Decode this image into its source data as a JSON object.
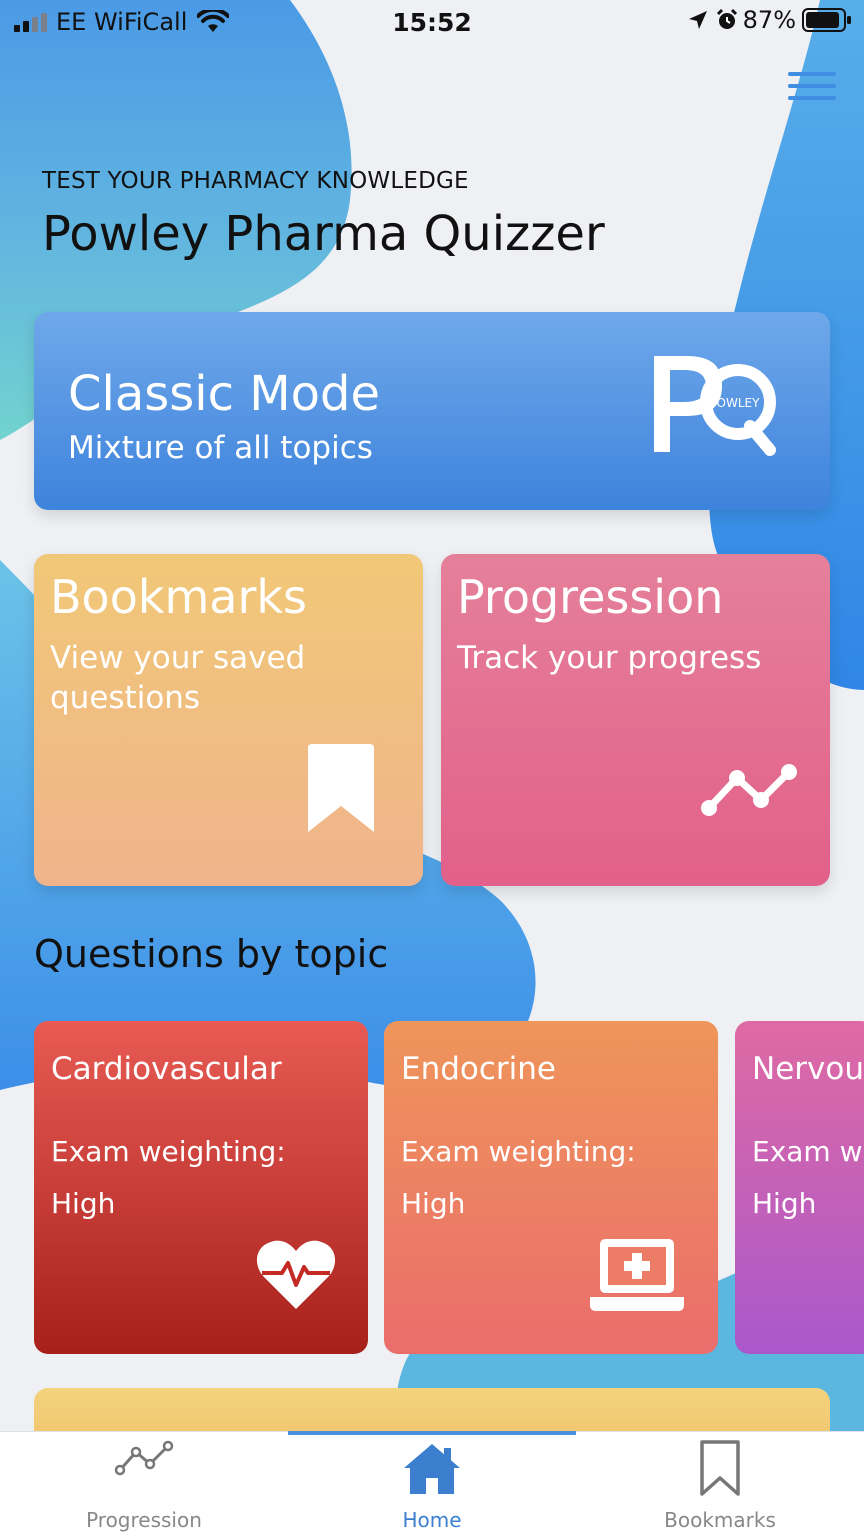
{
  "status_bar": {
    "carrier": "EE WiFiCall",
    "time": "15:52",
    "battery": "87%",
    "icons": [
      "signal-icon",
      "wifi-icon",
      "location-arrow-icon",
      "alarm-icon",
      "battery-icon"
    ]
  },
  "header": {
    "subtitle": "TEST YOUR PHARMACY KNOWLEDGE",
    "title": "Powley Pharma Quizzer",
    "menu_icon": "hamburger-menu-icon"
  },
  "classic_mode": {
    "title": "Classic Mode",
    "subtitle": "Mixture of all topics",
    "logo_letters": "PQ",
    "logo_text": "OWLEY",
    "colors": [
      "#6fa8ea",
      "#3e83dc"
    ]
  },
  "bookmarks_card": {
    "title": "Bookmarks",
    "subtitle": "View your saved questions",
    "icon": "bookmark-icon",
    "colors": [
      "#f1c877",
      "#f0b48c"
    ]
  },
  "progression_card": {
    "title": "Progression",
    "subtitle": "Track your progress",
    "icon": "line-chart-icon",
    "colors": [
      "#e5809a",
      "#e2608a"
    ]
  },
  "topics_section": {
    "title": "Questions by topic",
    "topics": [
      {
        "title": "Cardiovascular",
        "label": "Exam weighting:",
        "value": "High",
        "icon": "heartbeat-icon",
        "colors": [
          "#e85b55",
          "#a8201a"
        ]
      },
      {
        "title": "Endocrine",
        "label": "Exam weighting:",
        "value": "High",
        "icon": "laptop-medical-icon",
        "colors": [
          "#ef955a",
          "#ea6d6c"
        ]
      },
      {
        "title": "Nervou",
        "label": "Exam we",
        "value": "High",
        "icon": "",
        "colors": [
          "#df6aa3",
          "#a958cc"
        ]
      }
    ]
  },
  "tab_bar": {
    "tabs": [
      {
        "label": "Progression",
        "icon": "line-chart-icon",
        "active": false
      },
      {
        "label": "Home",
        "icon": "home-icon",
        "active": true
      },
      {
        "label": "Bookmarks",
        "icon": "bookmark-outline-icon",
        "active": false
      }
    ],
    "active_color": "#3b7fce"
  }
}
